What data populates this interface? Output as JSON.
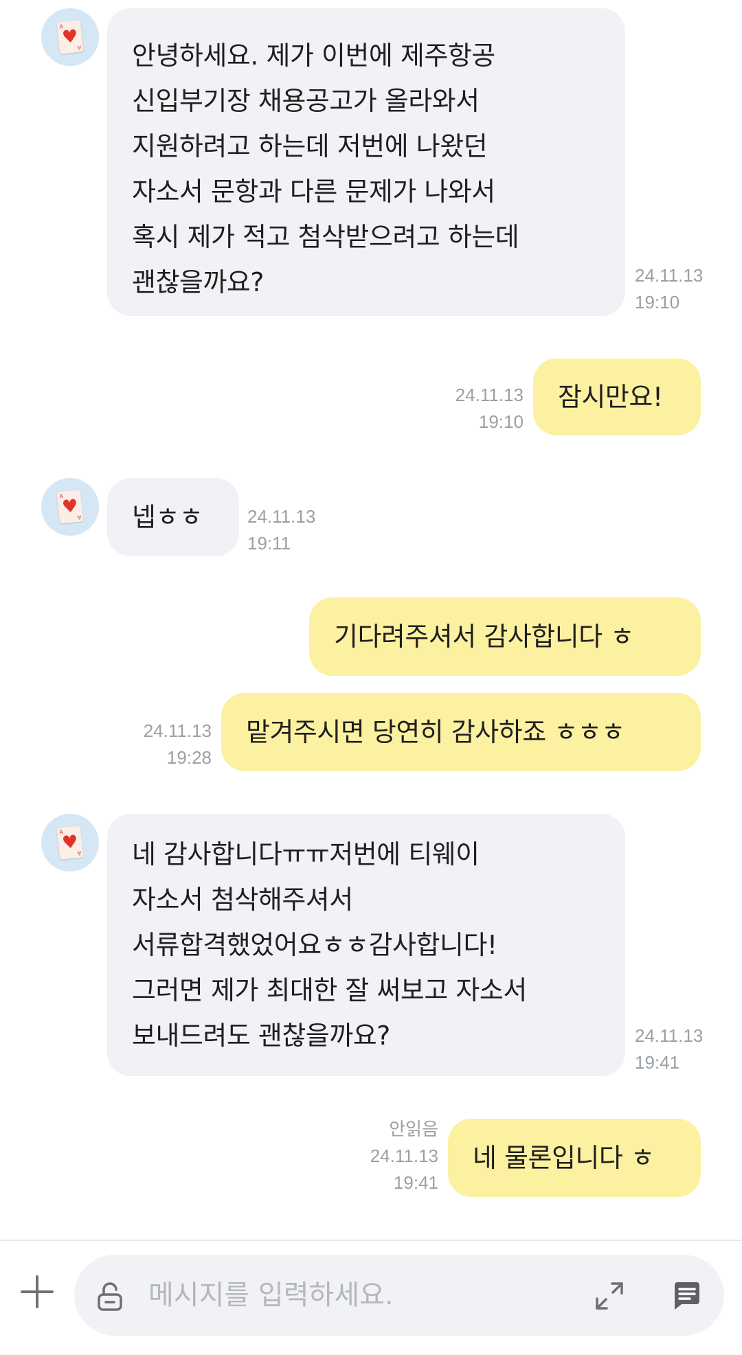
{
  "messages": [
    {
      "side": "in",
      "text": "안녕하세요. 제가 이번에 제주항공\n신입부기장 채용공고가 올라와서\n지원하려고 하는데 저번에 나왔던\n자소서 문항과 다른 문제가 나와서\n혹시 제가 적고 첨삭받으려고 하는데\n괜찮을까요?",
      "date": "24.11.13",
      "time": "19:10"
    },
    {
      "side": "out",
      "text": "잠시만요!",
      "date": "24.11.13",
      "time": "19:10"
    },
    {
      "side": "in",
      "text": "넵ㅎㅎ",
      "date": "24.11.13",
      "time": "19:11"
    },
    {
      "side": "out",
      "text": "기다려주셔서 감사합니다 ㅎ"
    },
    {
      "side": "out",
      "text": "맡겨주시면 당연히 감사하죠 ㅎㅎㅎ",
      "date": "24.11.13",
      "time": "19:28"
    },
    {
      "side": "in",
      "text": "네 감사합니다ㅠㅠ저번에 티웨이\n자소서 첨삭해주셔서\n서류합격했었어요ㅎㅎ감사합니다!\n그러면 제가 최대한 잘 써보고 자소서\n보내드려도 괜찮을까요?",
      "date": "24.11.13",
      "time": "19:41"
    },
    {
      "side": "out",
      "text": "네 물론입니다 ㅎ",
      "status": "안읽음",
      "date": "24.11.13",
      "time": "19:41"
    }
  ],
  "composer": {
    "placeholder": "메시지를 입력하세요.",
    "icons": [
      "plus-icon",
      "lock-icon",
      "expand-icon",
      "send-icon"
    ]
  },
  "colors": {
    "incoming_bubble": "#f1f2f6",
    "outgoing_bubble": "#fcf1a0",
    "timestamp": "#9aa0a6",
    "avatar_bg": "#d5e6f5"
  }
}
